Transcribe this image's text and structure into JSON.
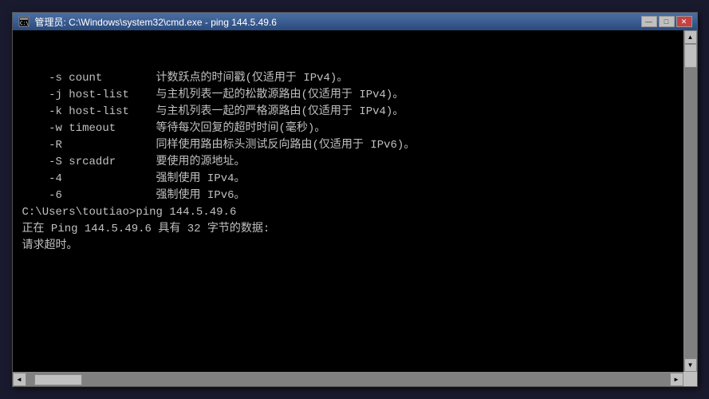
{
  "window": {
    "title": "管理员: C:\\Windows\\system32\\cmd.exe - ping  144.5.49.6"
  },
  "titlebar": {
    "minimize_label": "—",
    "maximize_label": "□",
    "close_label": "✕"
  },
  "terminal": {
    "lines": [
      {
        "id": "line1",
        "text": "    -s count        计数跃点的时间戳(仅适用于 IPv4)。"
      },
      {
        "id": "line2",
        "text": "    -j host-list    与主机列表一起的松散源路由(仅适用于 IPv4)。"
      },
      {
        "id": "line3",
        "text": "    -k host-list    与主机列表一起的严格源路由(仅适用于 IPv4)。"
      },
      {
        "id": "line4",
        "text": "    -w timeout      等待每次回复的超时时间(毫秒)。"
      },
      {
        "id": "line5",
        "text": "    -R              同样使用路由标头测试反向路由(仅适用于 IPv6)。"
      },
      {
        "id": "line6",
        "text": "    -S srcaddr      要使用的源地址。"
      },
      {
        "id": "line7",
        "text": "    -4              强制使用 IPv4。"
      },
      {
        "id": "line8",
        "text": "    -6              强制使用 IPv6。"
      },
      {
        "id": "line9",
        "text": ""
      },
      {
        "id": "line10",
        "text": ""
      },
      {
        "id": "line11",
        "text": "C:\\Users\\toutiao>ping 144.5.49.6"
      },
      {
        "id": "line12",
        "text": ""
      },
      {
        "id": "line13",
        "text": "正在 Ping 144.5.49.6 具有 32 字节的数据:"
      },
      {
        "id": "line14",
        "text": "请求超时。"
      }
    ]
  }
}
